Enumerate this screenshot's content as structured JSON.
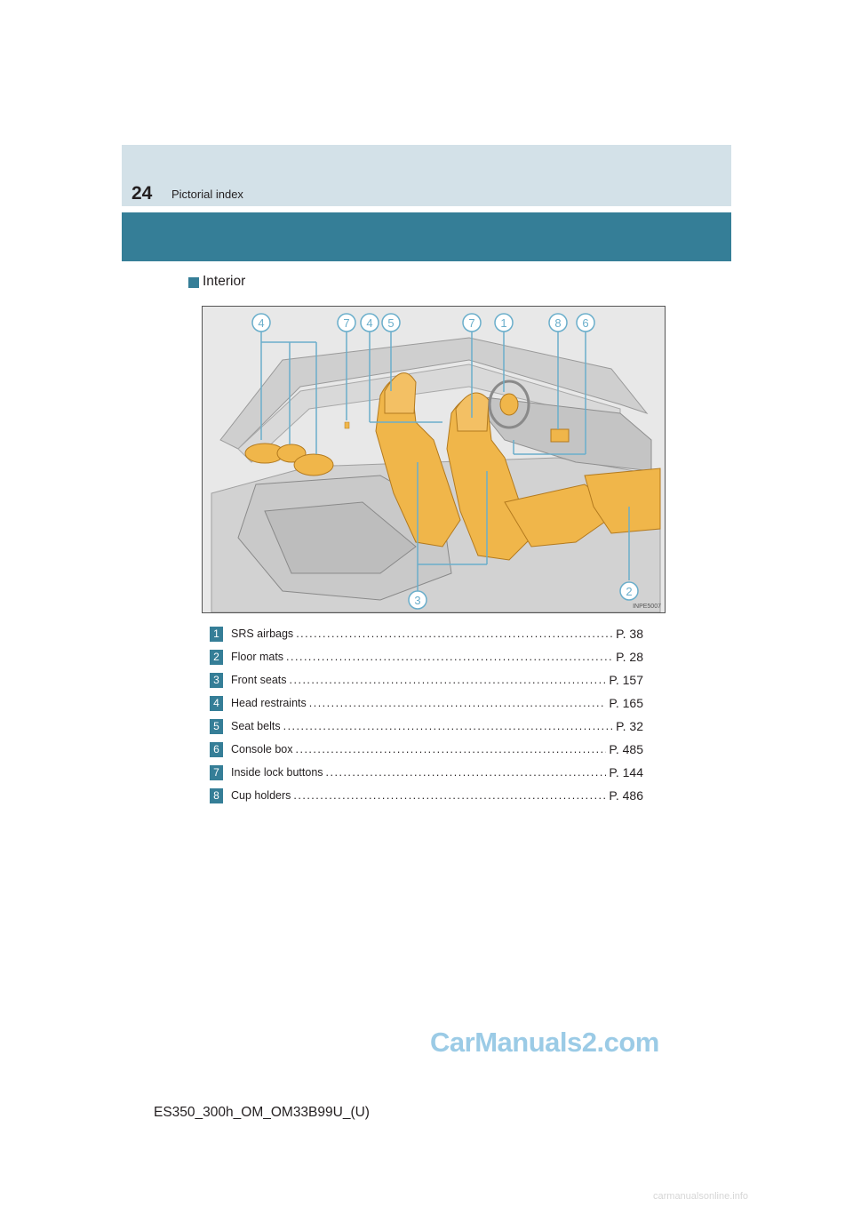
{
  "header": {
    "page_number": "24",
    "section_title": "Pictorial index"
  },
  "sub_heading": "Interior",
  "figure": {
    "code": "INPE5007",
    "callouts": [
      "4",
      "7",
      "4",
      "5",
      "7",
      "1",
      "8",
      "6",
      "3",
      "2"
    ]
  },
  "items": [
    {
      "num": "1",
      "label": "SRS airbags",
      "ref": "P. 38"
    },
    {
      "num": "2",
      "label": "Floor mats",
      "ref": "P. 28"
    },
    {
      "num": "3",
      "label": "Front seats",
      "ref": "P. 157"
    },
    {
      "num": "4",
      "label": "Head restraints",
      "ref": "P. 165"
    },
    {
      "num": "5",
      "label": "Seat belts",
      "ref": "P. 32"
    },
    {
      "num": "6",
      "label": "Console box",
      "ref": "P. 485"
    },
    {
      "num": "7",
      "label": "Inside lock buttons",
      "ref": "P. 144"
    },
    {
      "num": "8",
      "label": "Cup holders",
      "ref": "P. 486"
    }
  ],
  "footer": "ES350_300h_OM_OM33B99U_(U)",
  "watermark": "CarManuals2.com",
  "bottom_watermark": "carmanualsonline.info",
  "colors": {
    "header_light": "#d3e1e8",
    "header_dark": "#357e97",
    "highlight": "#f0b64a",
    "callout_line": "#6aaecb"
  }
}
